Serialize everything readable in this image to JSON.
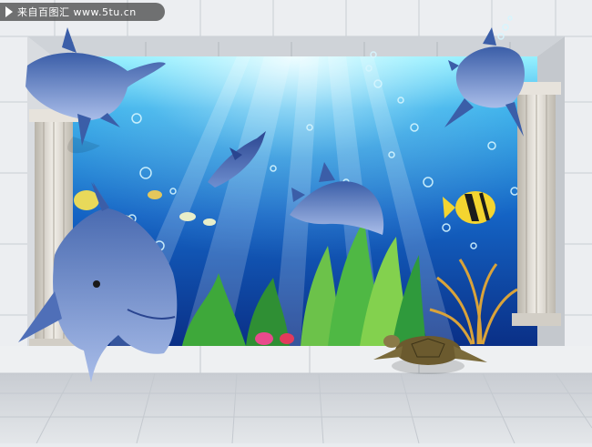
{
  "watermark": {
    "text": "来自百图汇 www.5tu.cn",
    "icon": "play-triangle-icon"
  },
  "colors": {
    "wall": "#e9ecef",
    "tile_line": "#c9ced4",
    "frame": "#b9bec4",
    "water_top": "#7fe8ff",
    "water_mid": "#1b84d6",
    "water_deep": "#083a8c",
    "dolphin": "#4f6fb8",
    "dolphin_light": "#9fb3e6",
    "column": "#dcd8d0",
    "floor": "#d7dadf"
  }
}
